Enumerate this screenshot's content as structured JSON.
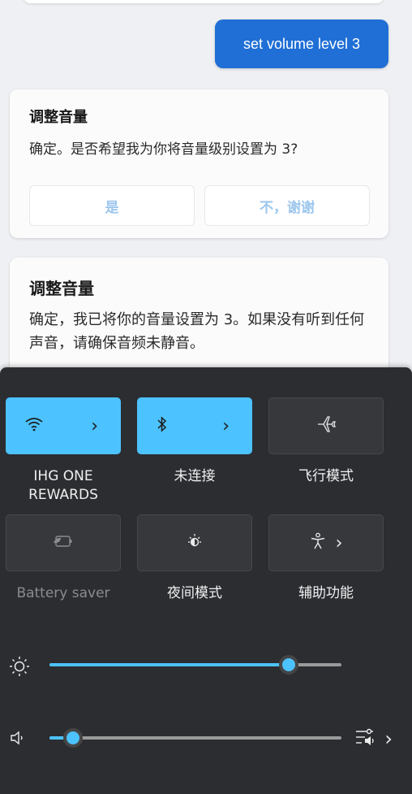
{
  "chat": {
    "user_message": "set volume level 3",
    "card1": {
      "title": "调整音量",
      "text": "确定。是否希望我为你将音量级别设置为 3?",
      "yes_label": "是",
      "no_label": "不，谢谢"
    },
    "card2": {
      "title": "调整音量",
      "text": "确定，我已将你的音量设置为 3。如果没有听到任何声音，请确保音频未静音。"
    }
  },
  "quick_settings": {
    "wifi": {
      "label": "IHG ONE REWARDS",
      "active": true,
      "icon": "wifi-icon"
    },
    "bluetooth": {
      "label": "未连接",
      "active": true,
      "icon": "bluetooth-icon"
    },
    "airplane": {
      "label": "飞行模式",
      "active": false,
      "icon": "airplane-icon"
    },
    "battery_saver": {
      "label": "Battery saver",
      "active": false,
      "disabled": true,
      "icon": "battery-saver-icon"
    },
    "night_light": {
      "label": "夜间模式",
      "active": false,
      "icon": "night-light-icon"
    },
    "accessibility": {
      "label": "辅助功能",
      "active": false,
      "icon": "accessibility-icon"
    },
    "brightness": {
      "level": 0.82,
      "icon": "sun-icon"
    },
    "volume": {
      "level": 0.08,
      "icon": "speaker-icon"
    },
    "accent_color": "#4cc2ff",
    "panel_color": "#2b2d31"
  }
}
